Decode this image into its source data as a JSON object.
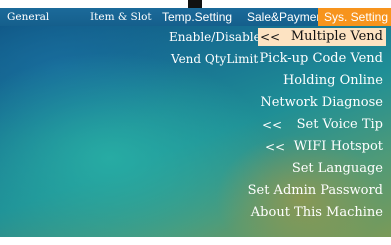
{
  "tabs": [
    {
      "label": "General",
      "active": false
    },
    {
      "label": "Item & Slot",
      "active": false
    },
    {
      "label": "Temp.Setting",
      "active": false
    },
    {
      "label": "Sale&Payment",
      "active": false
    },
    {
      "label": "Sys. Setting",
      "active": true
    }
  ],
  "left_labels": [
    "Enable/Disable",
    "Vend QtyLimit"
  ],
  "menu": [
    {
      "label": "Multiple Vend",
      "arrow": "<<",
      "selected": true
    },
    {
      "label": "Pick-up Code Vend",
      "arrow": "",
      "selected": false
    },
    {
      "label": "Holding Online",
      "arrow": "",
      "selected": false
    },
    {
      "label": "Network Diagnose",
      "arrow": "",
      "selected": false
    },
    {
      "label": "Set Voice Tip",
      "arrow": "<<",
      "selected": false
    },
    {
      "label": "WIFI Hotspot",
      "arrow": "<<",
      "selected": false
    },
    {
      "label": "Set Language",
      "arrow": "",
      "selected": false
    },
    {
      "label": "Set Admin Password",
      "arrow": "",
      "selected": false
    },
    {
      "label": "About This Machine",
      "arrow": "",
      "selected": false
    }
  ],
  "colors": {
    "tab_bar": "#1b6a9a",
    "active_tab": "#f7941d",
    "selected_row": "#fde3c2",
    "text": "#ffffff"
  }
}
